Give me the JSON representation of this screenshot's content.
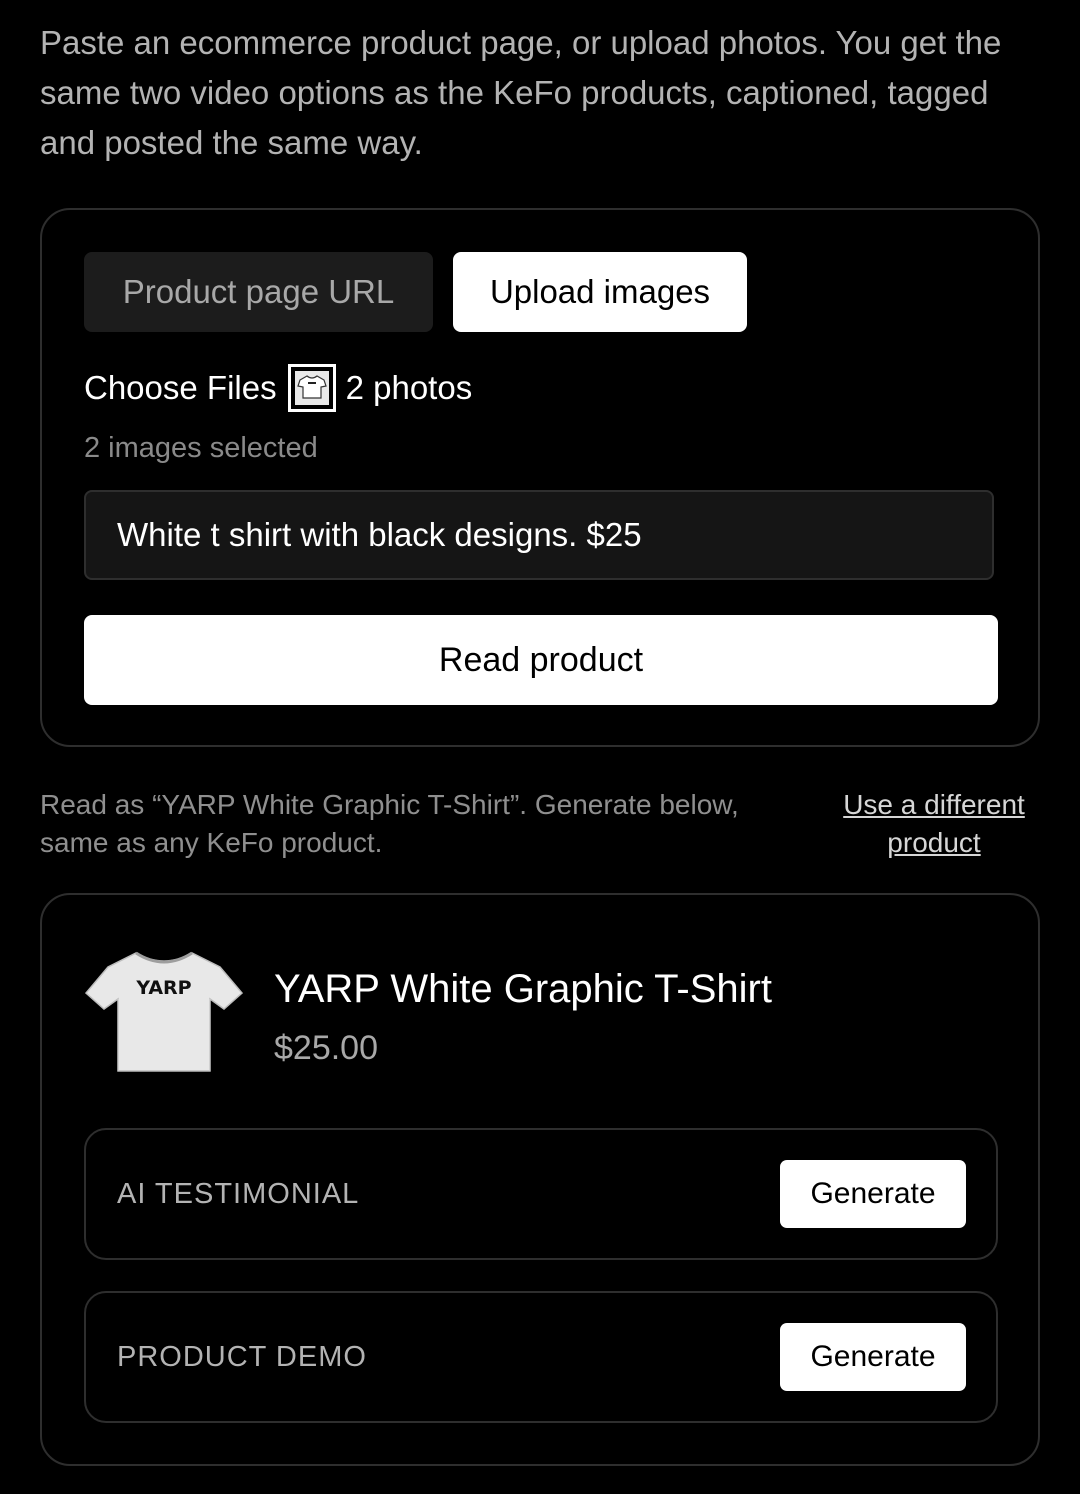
{
  "intro": {
    "text": "Paste an ecommerce product page, or upload photos. You get the same two video options as the KeFo products, captioned, tagged and posted the same way."
  },
  "source_tabs": {
    "url_label": "Product page URL",
    "upload_label": "Upload images",
    "active": "upload"
  },
  "file_picker": {
    "button_label": "Choose Files",
    "count_label": "2 photos",
    "selected_hint": "2 images selected"
  },
  "description_input": {
    "value": "White t shirt with black designs. $25"
  },
  "read_button": {
    "label": "Read product"
  },
  "status": {
    "text": "Read as “YARP White Graphic T-Shirt”. Generate below, same as any KeFo product.",
    "change_link": "Use a different product"
  },
  "product": {
    "image_logo": "YARP",
    "title": "YARP White Graphic T-Shirt",
    "price": "$25.00"
  },
  "video_options": [
    {
      "label": "AI TESTIMONIAL",
      "button": "Generate"
    },
    {
      "label": "PRODUCT DEMO",
      "button": "Generate"
    }
  ],
  "colors": {
    "background": "#000000",
    "panel_border": "#2e2e2e",
    "primary_button": "#ffffff",
    "muted_text": "#8f8f8f"
  }
}
